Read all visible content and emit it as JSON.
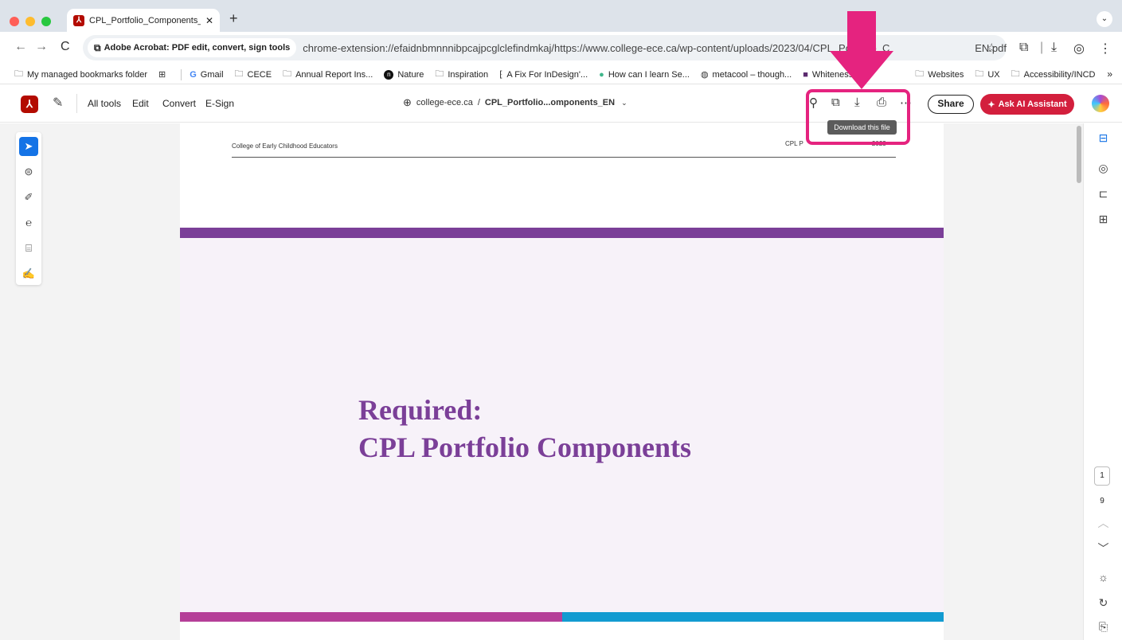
{
  "browser": {
    "tab_title": "CPL_Portfolio_Components_",
    "tab_close": "✕",
    "new_tab": "+",
    "site_chip": "Adobe Acrobat: PDF edit, convert, sign tools",
    "url": "chrome-extension://efaidnbmnnnibpcajpcglclefindmkaj/https://www.college-ece.ca/wp-content/uploads/2023/04/CPL_Portfolio_C",
    "url_tail": "EN.pdf",
    "bookmarks": [
      {
        "label": "My managed bookmarks folder",
        "icon": "folder-icon"
      },
      {
        "label": "Gmail",
        "icon": "google-icon"
      },
      {
        "label": "CECE",
        "icon": "folder-icon"
      },
      {
        "label": "Annual Report Ins...",
        "icon": "folder-icon"
      },
      {
        "label": "Nature",
        "icon": "nature-icon"
      },
      {
        "label": "Inspiration",
        "icon": "folder-icon"
      },
      {
        "label": "A Fix For InDesign'...",
        "icon": "page-icon"
      },
      {
        "label": "How can I learn Se...",
        "icon": "dot-icon"
      },
      {
        "label": "metacool – though...",
        "icon": "globe-icon"
      },
      {
        "label": "Whiteness | I",
        "icon": "square-icon"
      },
      {
        "label": "Websites",
        "icon": "folder-icon"
      },
      {
        "label": "UX",
        "icon": "folder-icon"
      },
      {
        "label": "Accessibility/INCD",
        "icon": "folder-icon"
      }
    ],
    "bookmarks_more": "»"
  },
  "acrobat": {
    "menu": [
      "All tools",
      "Edit",
      "Convert",
      "E-Sign"
    ],
    "doc_domain": "college-ece.ca",
    "doc_separator": "/",
    "doc_name": "CPL_Portfolio...omponents_EN",
    "share": "Share",
    "ask_ai": "Ask AI Assistant",
    "tooltip": "Download this file"
  },
  "document": {
    "header_left": "College of Early Childhood Educators",
    "header_right": "CPL P",
    "header_right_tail": "2023",
    "title_line1": "Required:",
    "title_line2": "CPL Portfolio Components"
  },
  "pager": {
    "current": "1",
    "total": "9"
  },
  "colors": {
    "acrobat_red": "#b30b00",
    "highlight": "#e5237f",
    "brand_purple": "#7b3f98",
    "band_magenta": "#b53f98",
    "band_blue": "#129bd1",
    "ai_button": "#d31f3d"
  }
}
